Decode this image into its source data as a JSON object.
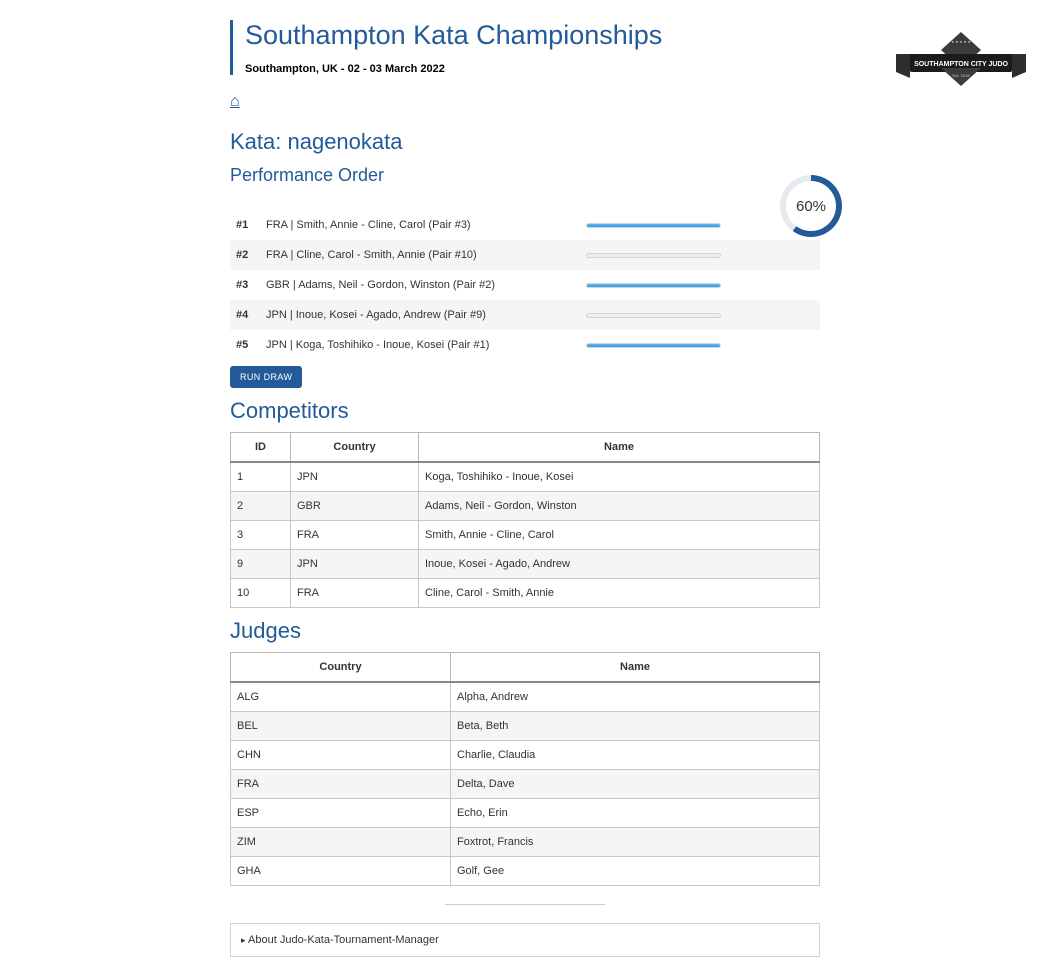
{
  "header": {
    "title": "Southampton Kata Championships",
    "subtitle": "Southampton, UK - 02 - 03 March 2022",
    "logo_main": "SOUTHAMPTON CITY JUDO",
    "logo_stars": "★ ★ ★ ★ ★",
    "logo_est": "Est. 2019",
    "home_glyph": "⌂"
  },
  "kata_heading": "Kata: nagenokata",
  "perf_heading": "Performance Order",
  "progress_label": "60%",
  "run_draw_label": "RUN DRAW",
  "performance": [
    {
      "idx": "#1",
      "label": "FRA | Smith, Annie - Cline, Carol (Pair #3)",
      "done": true
    },
    {
      "idx": "#2",
      "label": "FRA | Cline, Carol - Smith, Annie (Pair #10)",
      "done": false
    },
    {
      "idx": "#3",
      "label": "GBR | Adams, Neil - Gordon, Winston (Pair #2)",
      "done": true
    },
    {
      "idx": "#4",
      "label": "JPN | Inoue, Kosei - Agado, Andrew (Pair #9)",
      "done": false
    },
    {
      "idx": "#5",
      "label": "JPN | Koga, Toshihiko - Inoue, Kosei (Pair #1)",
      "done": true
    }
  ],
  "competitors_heading": "Competitors",
  "competitors_cols": {
    "id": "ID",
    "country": "Country",
    "name": "Name"
  },
  "competitors": [
    {
      "id": "1",
      "country": "JPN",
      "name": "Koga, Toshihiko - Inoue, Kosei"
    },
    {
      "id": "2",
      "country": "GBR",
      "name": "Adams, Neil - Gordon, Winston"
    },
    {
      "id": "3",
      "country": "FRA",
      "name": "Smith, Annie - Cline, Carol"
    },
    {
      "id": "9",
      "country": "JPN",
      "name": "Inoue, Kosei - Agado, Andrew"
    },
    {
      "id": "10",
      "country": "FRA",
      "name": "Cline, Carol - Smith, Annie"
    }
  ],
  "judges_heading": "Judges",
  "judges_cols": {
    "country": "Country",
    "name": "Name"
  },
  "judges": [
    {
      "country": "ALG",
      "name": "Alpha, Andrew"
    },
    {
      "country": "BEL",
      "name": "Beta, Beth"
    },
    {
      "country": "CHN",
      "name": "Charlie, Claudia"
    },
    {
      "country": "FRA",
      "name": "Delta, Dave"
    },
    {
      "country": "ESP",
      "name": "Echo, Erin"
    },
    {
      "country": "ZIM",
      "name": "Foxtrot, Francis"
    },
    {
      "country": "GHA",
      "name": "Golf, Gee"
    }
  ],
  "about_label": "About Judo-Kata-Tournament-Manager"
}
